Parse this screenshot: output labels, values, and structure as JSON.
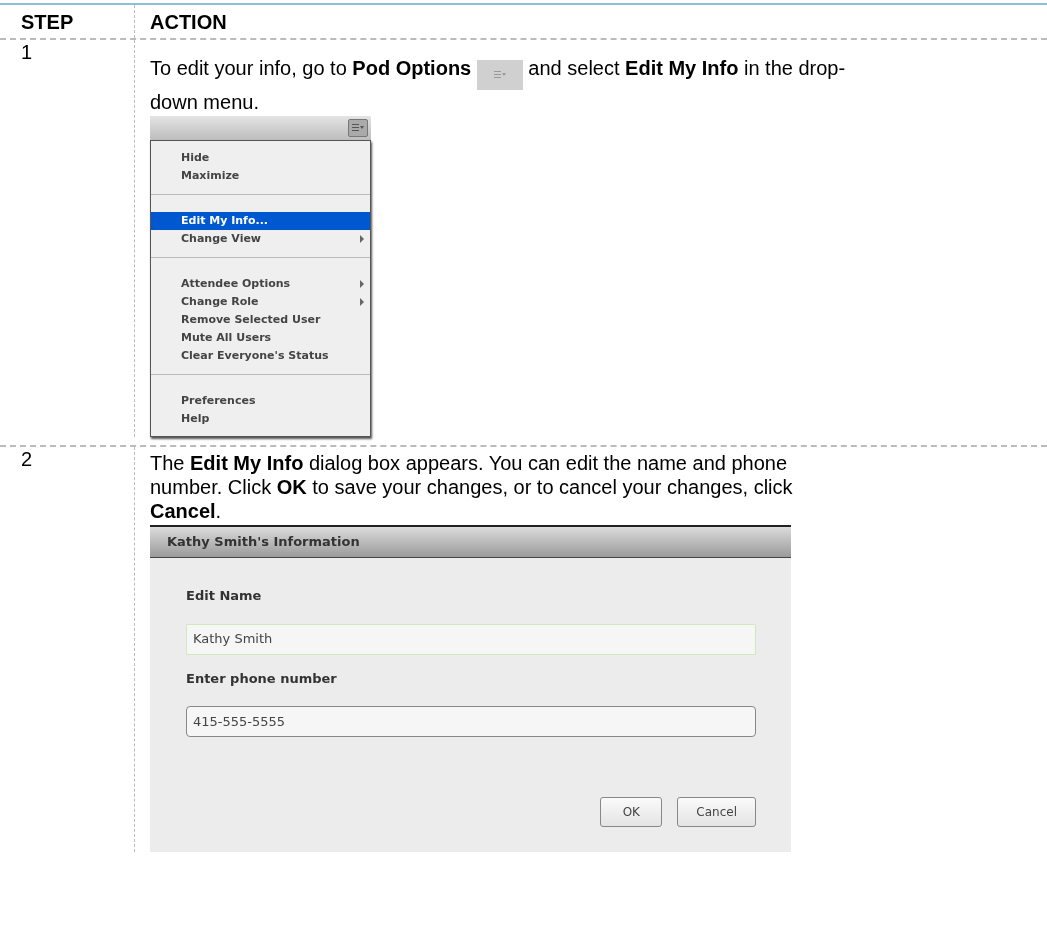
{
  "table": {
    "columns": [
      "STEP",
      "ACTION"
    ],
    "rows": [
      {
        "step": "1",
        "text_before": "To edit your info, go to **Pod Options**",
        "text_after": "and select **Edit My Info** in the drop-down menu.",
        "menu": {
          "items": [
            {
              "kind": "item",
              "label": "Hide",
              "selected": false,
              "submenu": false
            },
            {
              "kind": "item",
              "label": "Maximize",
              "selected": false,
              "submenu": false
            },
            {
              "kind": "separator"
            },
            {
              "kind": "item",
              "label": "Edit My Info...",
              "selected": true,
              "submenu": false
            },
            {
              "kind": "item",
              "label": "Change View",
              "selected": false,
              "submenu": true
            },
            {
              "kind": "separator"
            },
            {
              "kind": "item",
              "label": "Attendee Options",
              "selected": false,
              "submenu": true
            },
            {
              "kind": "item",
              "label": "Change Role",
              "selected": false,
              "submenu": true
            },
            {
              "kind": "item",
              "label": "Remove Selected User",
              "selected": false,
              "submenu": false
            },
            {
              "kind": "item",
              "label": "Mute All Users",
              "selected": false,
              "submenu": false
            },
            {
              "kind": "item",
              "label": "Clear Everyone's Status",
              "selected": false,
              "submenu": false
            },
            {
              "kind": "separator"
            },
            {
              "kind": "item",
              "label": "Preferences",
              "selected": false,
              "submenu": false
            },
            {
              "kind": "item",
              "label": "Help",
              "selected": false,
              "submenu": false
            }
          ]
        }
      },
      {
        "step": "2",
        "text": "The **Edit My Info** dialog box appears.  You can edit the name and phone number.  Click **OK** to save your changes, or to cancel your changes, click **Cancel**.",
        "dialog": {
          "title": "Kathy Smith's Information",
          "fields": [
            {
              "label": "Edit Name",
              "value": "Kathy Smith",
              "focused": true
            },
            {
              "label": "Enter phone number",
              "value": "415-555-5555",
              "focused": false
            }
          ],
          "buttons": [
            "OK",
            "Cancel"
          ]
        }
      }
    ]
  }
}
